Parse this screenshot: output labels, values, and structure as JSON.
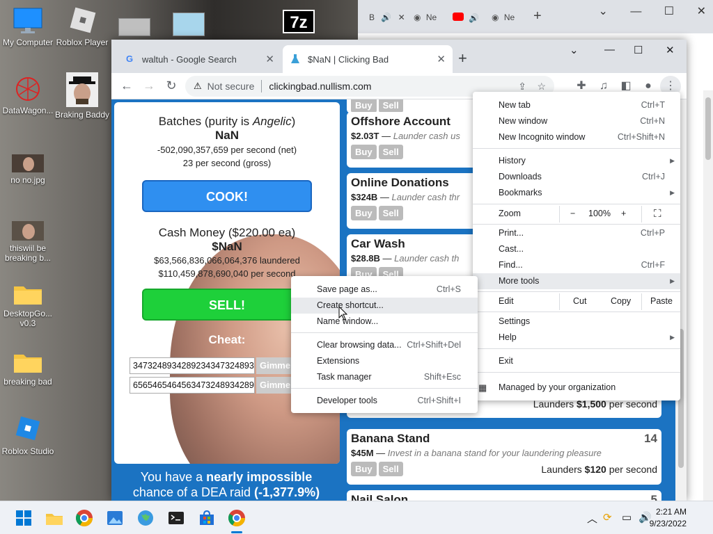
{
  "desktop": {
    "icons": [
      {
        "label": "My Computer"
      },
      {
        "label": "Roblox Player"
      },
      {
        "label": "DataWagon..."
      },
      {
        "label": "Braking Baddy"
      },
      {
        "label": "no no.jpg"
      },
      {
        "label": "thiswiil be breaking b..."
      },
      {
        "label": "DesktopGo... v0.3"
      },
      {
        "label": "breaking bad"
      },
      {
        "label": "Roblox Studio"
      }
    ],
    "top_icon": "7z"
  },
  "bg_window": {
    "tabs": [
      {
        "label": "B"
      },
      {
        "label": "Ne"
      },
      {
        "label": "Ne"
      }
    ]
  },
  "browser": {
    "tabs": [
      {
        "label": "waltuh - Google Search",
        "favicon": "G"
      },
      {
        "label": "$NaN | Clicking Bad",
        "favicon": "flask"
      }
    ],
    "security": "Not secure",
    "url": "clickingbad.nullism.com"
  },
  "game": {
    "batches_title_pre": "Batches (purity is ",
    "batches_purity": "Angelic",
    "batches_title_post": ")",
    "batches_value": "NaN",
    "batches_net": "-502,090,357,659 per second (net)",
    "batches_gross": "23 per second (gross)",
    "cook_label": "COOK!",
    "cash_title": "Cash Money ($220.00 ea)",
    "cash_value": "$NaN",
    "laundered": "$63,566,836,066,064,376 laundered",
    "unlaundered": "$110,459,878,690,040 per second",
    "sell_label": "SELL!",
    "cheat_label": "Cheat:",
    "cheat_inputs": [
      "3473248934289234347324893",
      "6565465464563473248934289"
    ],
    "gimme_label": "Gimme",
    "dea_pre": "You have a ",
    "dea_bold": "nearly impossible",
    "dea_mid": " chance of a DEA raid ",
    "dea_pct": "(-1,377.9%)",
    "cards": [
      {
        "name": "Offshore Account",
        "cost": "$2.03T",
        "desc": "Launder cash us",
        "owned": "",
        "rate_pre": "",
        "rate_val": "",
        "rate_post": ""
      },
      {
        "name": "Online Donations",
        "cost": "$324B",
        "desc": "Launder cash thr",
        "owned": "",
        "rate_pre": "",
        "rate_val": "",
        "rate_post": ""
      },
      {
        "name": "Car Wash",
        "cost": "$28.8B",
        "desc": "Launder cash th",
        "owned": "",
        "rate_pre": "",
        "rate_val": "",
        "rate_post": ""
      },
      {
        "name": "",
        "cost": "",
        "desc": "",
        "owned": "",
        "rate_pre": "Launders ",
        "rate_val": "$1,500",
        "rate_post": " per second"
      },
      {
        "name": "Banana Stand",
        "cost": "$45M",
        "desc": "Invest in a banana stand for your laundering pleasure",
        "owned": "14",
        "rate_pre": "Launders ",
        "rate_val": "$120",
        "rate_post": " per second"
      },
      {
        "name": "Nail Salon",
        "cost": "",
        "desc": "",
        "owned": "5",
        "rate_pre": "",
        "rate_val": "",
        "rate_post": ""
      }
    ],
    "buy_label": "Buy",
    "sell_small_label": "Sell"
  },
  "chrome_menu": {
    "items": [
      {
        "label": "New tab",
        "shortcut": "Ctrl+T"
      },
      {
        "label": "New window",
        "shortcut": "Ctrl+N"
      },
      {
        "label": "New Incognito window",
        "shortcut": "Ctrl+Shift+N"
      },
      {
        "label": "History",
        "shortcut": ""
      },
      {
        "label": "Downloads",
        "shortcut": "Ctrl+J"
      },
      {
        "label": "Bookmarks",
        "shortcut": ""
      },
      {
        "label": "Print...",
        "shortcut": "Ctrl+P"
      },
      {
        "label": "Cast...",
        "shortcut": ""
      },
      {
        "label": "Find...",
        "shortcut": "Ctrl+F"
      },
      {
        "label": "More tools",
        "shortcut": ""
      },
      {
        "label": "Settings",
        "shortcut": ""
      },
      {
        "label": "Help",
        "shortcut": ""
      },
      {
        "label": "Exit",
        "shortcut": ""
      }
    ],
    "zoom_label": "Zoom",
    "zoom_minus": "−",
    "zoom_value": "100%",
    "zoom_plus": "+",
    "edit_label": "Edit",
    "cut": "Cut",
    "copy": "Copy",
    "paste": "Paste",
    "managed": "Managed by your organization"
  },
  "more_tools_menu": {
    "items": [
      {
        "label": "Save page as...",
        "shortcut": "Ctrl+S"
      },
      {
        "label": "Create shortcut...",
        "shortcut": ""
      },
      {
        "label": "Name window...",
        "shortcut": ""
      },
      {
        "label": "Clear browsing data...",
        "shortcut": "Ctrl+Shift+Del"
      },
      {
        "label": "Extensions",
        "shortcut": ""
      },
      {
        "label": "Task manager",
        "shortcut": "Shift+Esc"
      },
      {
        "label": "Developer tools",
        "shortcut": "Ctrl+Shift+I"
      }
    ]
  },
  "taskbar": {
    "time": "2:21 AM",
    "date": "9/23/2022"
  }
}
